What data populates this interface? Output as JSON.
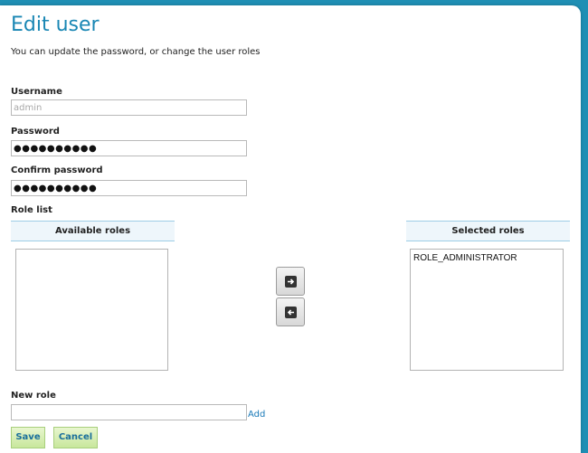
{
  "page": {
    "title": "Edit user",
    "subtitle": "You can update the password, or change the user roles"
  },
  "form": {
    "username_label": "Username",
    "username_value": "admin",
    "password_label": "Password",
    "password_value": "●●●●●●●●●●",
    "confirm_label": "Confirm password",
    "confirm_value": "●●●●●●●●●●",
    "role_list_label": "Role list"
  },
  "roles": {
    "available_header": "Available roles",
    "selected_header": "Selected roles",
    "available": [],
    "selected": [
      "ROLE_ADMINISTRATOR"
    ],
    "add_icon": "arrow-right-icon",
    "remove_icon": "arrow-left-icon"
  },
  "new_role": {
    "label": "New role",
    "value": "",
    "add_link": "Add"
  },
  "actions": {
    "save": "Save",
    "cancel": "Cancel"
  },
  "colors": {
    "title": "#1a87b4",
    "link": "#1a7ab8",
    "button_bg": "#d5edb3",
    "header_bg": "#eef6fb",
    "background": "#1f8fb4"
  }
}
